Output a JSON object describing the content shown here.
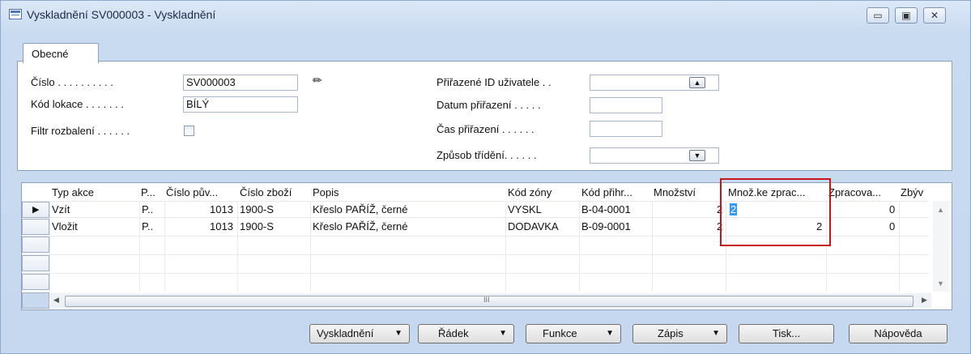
{
  "window": {
    "title": "Vyskladnění SV000003 - Vyskladnění",
    "min": "▭",
    "max": "▣",
    "close": "✕"
  },
  "tab": {
    "label": "Obecné"
  },
  "form": {
    "cislo_label": "Číslo . . . . . . . . . .",
    "cislo_value": "SV000003",
    "lokace_label": "Kód lokace . . . . . . .",
    "lokace_value": "BÍLÝ",
    "filtr_label": "Filtr rozbalení . . . . . .",
    "uzivatel_label": "Přiřazené ID uživatele . .",
    "datum_label": "Datum přiřazení . . . . .",
    "cas_label": "Čas přiřazení . . . . . .",
    "trideni_label": "Způsob třídění. . . . . ."
  },
  "grid": {
    "columns": [
      "Typ akce",
      "P...",
      "Číslo pův...",
      "Číslo zboží",
      "Popis",
      "Kód zóny",
      "Kód přihr...",
      "Množství",
      "Množ.ke zprac...",
      "Zpracova...",
      "Zbýv"
    ],
    "rows": [
      {
        "marker": "▶",
        "typ": "Vzít",
        "p": "P..",
        "cislo_puv": "1013",
        "cislo_zbozi": "1900-S",
        "popis": "Křeslo PAŘÍŽ, černé",
        "zona": "VYSKL",
        "prihr": "B-04-0001",
        "mnozstvi": "2",
        "ke_zprac": "2",
        "zpracova": "0"
      },
      {
        "marker": "",
        "typ": "Vložit",
        "p": "P..",
        "cislo_puv": "1013",
        "cislo_zbozi": "1900-S",
        "popis": "Křeslo PAŘÍŽ, černé",
        "zona": "DODAVKA",
        "prihr": "B-09-0001",
        "mnozstvi": "2",
        "ke_zprac": "2",
        "zpracova": "0"
      }
    ],
    "scroll_mid": "III"
  },
  "buttons": {
    "vyskladneni": "Vyskladnění",
    "radek": "Řádek",
    "funkce": "Funkce",
    "zapis": "Zápis",
    "tisk": "Tisk...",
    "napoveda": "Nápověda"
  },
  "icons": {
    "dropdown": "▼",
    "up": "▲",
    "down": "▼",
    "left": "◀",
    "right": "▶"
  }
}
